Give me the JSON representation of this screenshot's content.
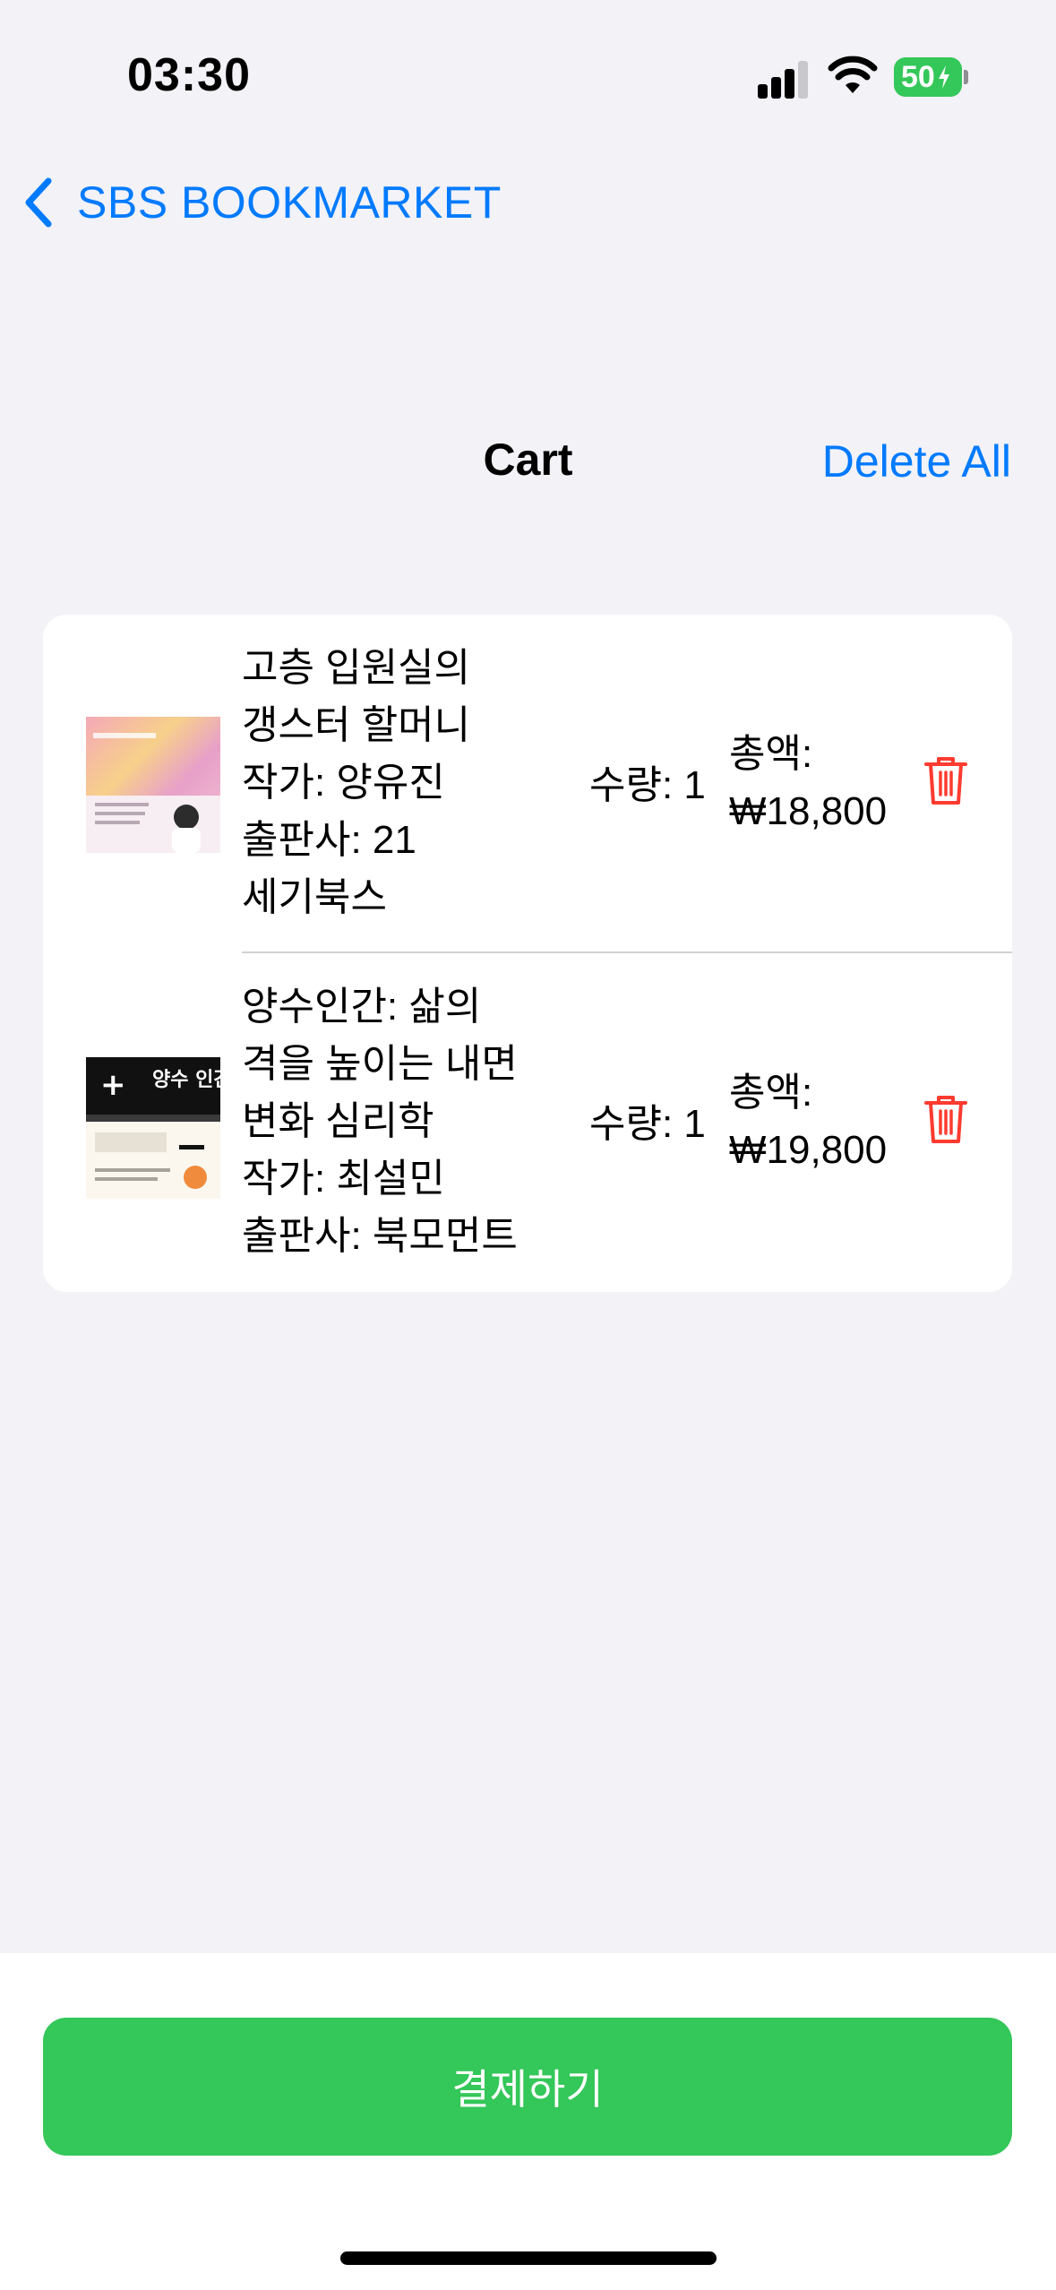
{
  "status_bar": {
    "time": "03:30",
    "battery": "50"
  },
  "nav": {
    "back_label": "SBS BOOKMARKET"
  },
  "header": {
    "title": "Cart",
    "delete_all": "Delete All"
  },
  "cart": {
    "items": [
      {
        "title_line1": "고층 입원실의",
        "title_line2": "갱스터 할머니",
        "author": "작가: 양유진",
        "publisher_line1": "출판사: 21",
        "publisher_line2": "세기북스",
        "quantity": "수량: 1",
        "total_label": "총액:",
        "total_value": "₩18,800"
      },
      {
        "title_line1": "양수인간: 삶의",
        "title_line2": "격을 높이는 내면",
        "title_line3": "변화 심리학",
        "author": "작가: 최설민",
        "publisher": "출판사: 북모먼트",
        "quantity": "수량: 1",
        "total_label": "총액:",
        "total_value": "₩19,800",
        "cover_text": "양수 인간"
      }
    ]
  },
  "checkout": {
    "label": "결제하기"
  },
  "colors": {
    "accent": "#007AFF",
    "success": "#34C759",
    "danger": "#FF3B30",
    "background": "#F2F2F7"
  }
}
